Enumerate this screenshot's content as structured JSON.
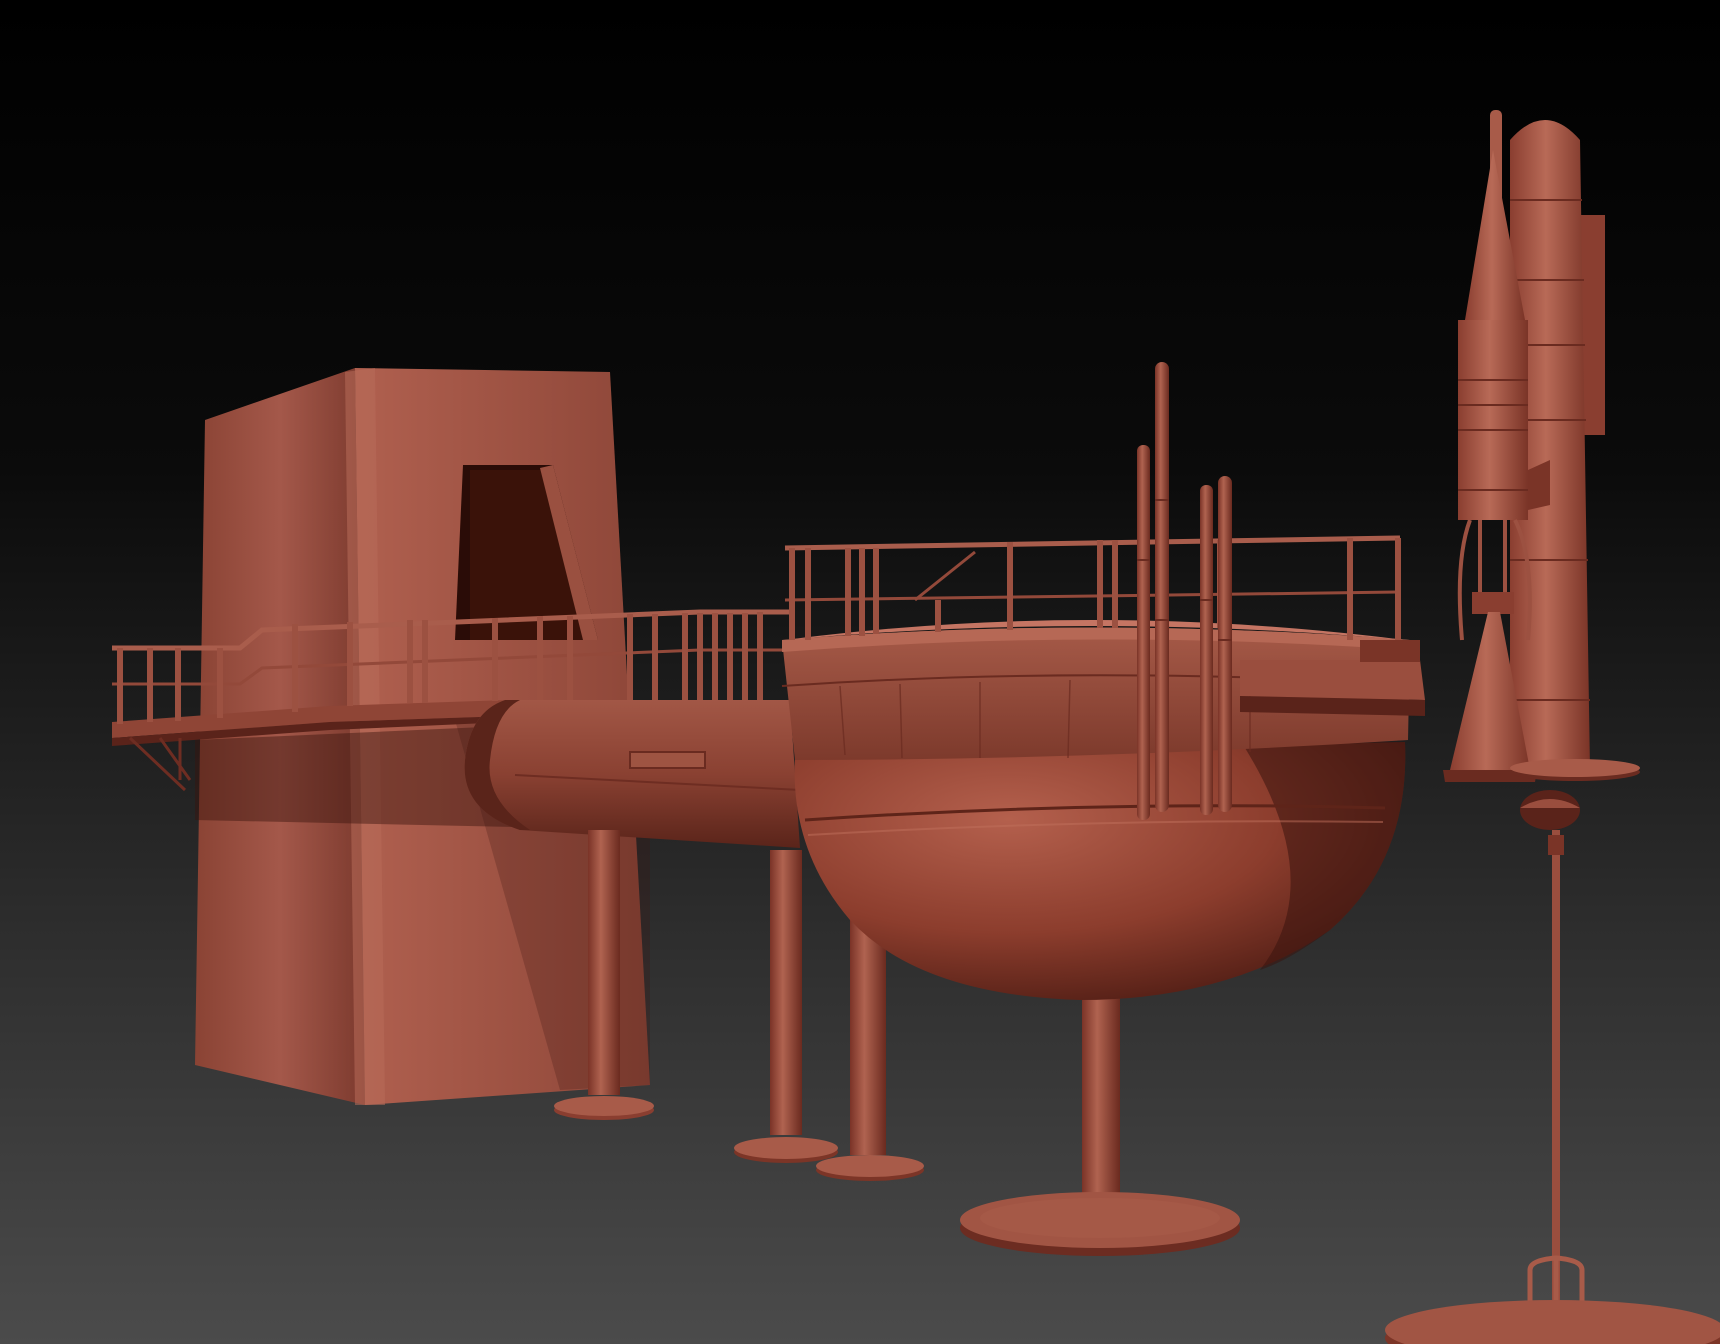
{
  "scene": {
    "kind": "3d-sculpt-viewport-render",
    "objects": [
      "tower-building",
      "walkway-with-railings",
      "tank-cylinder",
      "sphere-pod",
      "vertical-pipes",
      "rocket-stack",
      "trident-antenna",
      "support-pillars",
      "base-plates"
    ]
  },
  "colors": {
    "background_top": "#000000",
    "background_bottom": "#4a4a4a",
    "clay_light": "#b0614f",
    "clay_mid": "#8e4436",
    "clay_dark": "#5a231a",
    "clay_shadow": "#3a140e"
  }
}
